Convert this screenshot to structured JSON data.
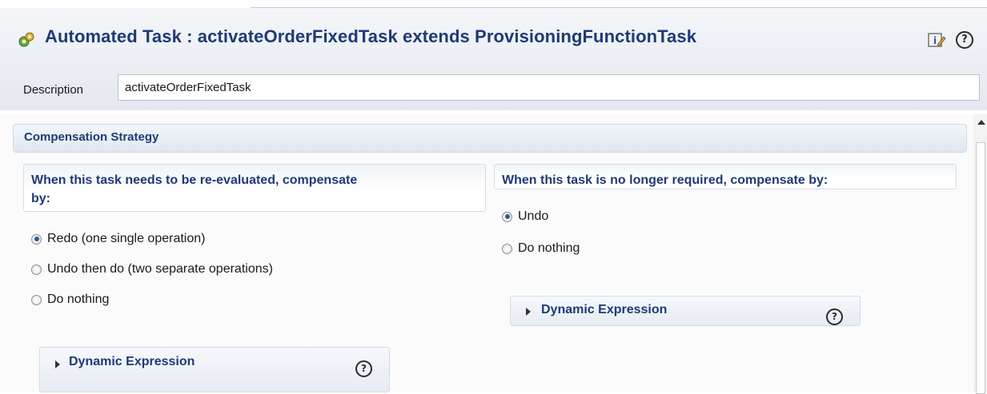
{
  "header": {
    "title": "Automated Task : activateOrderFixedTask extends ProvisioningFunctionTask",
    "task_icon": "automated-task-icon",
    "toolbar_icon": "edit-info-icon",
    "help_icon_glyph": "?"
  },
  "description": {
    "label": "Description",
    "value": "activateOrderFixedTask"
  },
  "compensation": {
    "section_title": "Compensation Strategy",
    "reevaluated": {
      "title_line1": "When this task needs to be re-evaluated, compensate",
      "title_line2": "by:",
      "options": [
        {
          "label": "Redo (one single operation)",
          "selected": true
        },
        {
          "label": "Undo then do (two separate operations)",
          "selected": false
        },
        {
          "label": "Do nothing",
          "selected": false
        }
      ],
      "dynamic_expression": "Dynamic Expression"
    },
    "no_longer_required": {
      "title": "When this task is no longer required, compensate by:",
      "options": [
        {
          "label": "Undo",
          "selected": true
        },
        {
          "label": "Do nothing",
          "selected": false
        }
      ],
      "dynamic_expression": "Dynamic Expression"
    }
  },
  "colors": {
    "title": "#1f3a74",
    "header_bg": "#e4e9ef",
    "radio_dot": "#31588c"
  }
}
